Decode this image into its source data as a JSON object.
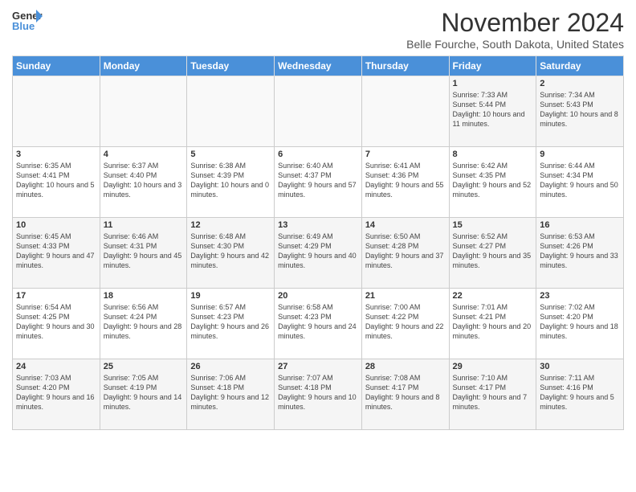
{
  "header": {
    "logo_line1": "General",
    "logo_line2": "Blue",
    "month": "November 2024",
    "location": "Belle Fourche, South Dakota, United States"
  },
  "days_of_week": [
    "Sunday",
    "Monday",
    "Tuesday",
    "Wednesday",
    "Thursday",
    "Friday",
    "Saturday"
  ],
  "weeks": [
    [
      {
        "day": "",
        "info": ""
      },
      {
        "day": "",
        "info": ""
      },
      {
        "day": "",
        "info": ""
      },
      {
        "day": "",
        "info": ""
      },
      {
        "day": "",
        "info": ""
      },
      {
        "day": "1",
        "info": "Sunrise: 7:33 AM\nSunset: 5:44 PM\nDaylight: 10 hours and 11 minutes."
      },
      {
        "day": "2",
        "info": "Sunrise: 7:34 AM\nSunset: 5:43 PM\nDaylight: 10 hours and 8 minutes."
      }
    ],
    [
      {
        "day": "3",
        "info": "Sunrise: 6:35 AM\nSunset: 4:41 PM\nDaylight: 10 hours and 5 minutes."
      },
      {
        "day": "4",
        "info": "Sunrise: 6:37 AM\nSunset: 4:40 PM\nDaylight: 10 hours and 3 minutes."
      },
      {
        "day": "5",
        "info": "Sunrise: 6:38 AM\nSunset: 4:39 PM\nDaylight: 10 hours and 0 minutes."
      },
      {
        "day": "6",
        "info": "Sunrise: 6:40 AM\nSunset: 4:37 PM\nDaylight: 9 hours and 57 minutes."
      },
      {
        "day": "7",
        "info": "Sunrise: 6:41 AM\nSunset: 4:36 PM\nDaylight: 9 hours and 55 minutes."
      },
      {
        "day": "8",
        "info": "Sunrise: 6:42 AM\nSunset: 4:35 PM\nDaylight: 9 hours and 52 minutes."
      },
      {
        "day": "9",
        "info": "Sunrise: 6:44 AM\nSunset: 4:34 PM\nDaylight: 9 hours and 50 minutes."
      }
    ],
    [
      {
        "day": "10",
        "info": "Sunrise: 6:45 AM\nSunset: 4:33 PM\nDaylight: 9 hours and 47 minutes."
      },
      {
        "day": "11",
        "info": "Sunrise: 6:46 AM\nSunset: 4:31 PM\nDaylight: 9 hours and 45 minutes."
      },
      {
        "day": "12",
        "info": "Sunrise: 6:48 AM\nSunset: 4:30 PM\nDaylight: 9 hours and 42 minutes."
      },
      {
        "day": "13",
        "info": "Sunrise: 6:49 AM\nSunset: 4:29 PM\nDaylight: 9 hours and 40 minutes."
      },
      {
        "day": "14",
        "info": "Sunrise: 6:50 AM\nSunset: 4:28 PM\nDaylight: 9 hours and 37 minutes."
      },
      {
        "day": "15",
        "info": "Sunrise: 6:52 AM\nSunset: 4:27 PM\nDaylight: 9 hours and 35 minutes."
      },
      {
        "day": "16",
        "info": "Sunrise: 6:53 AM\nSunset: 4:26 PM\nDaylight: 9 hours and 33 minutes."
      }
    ],
    [
      {
        "day": "17",
        "info": "Sunrise: 6:54 AM\nSunset: 4:25 PM\nDaylight: 9 hours and 30 minutes."
      },
      {
        "day": "18",
        "info": "Sunrise: 6:56 AM\nSunset: 4:24 PM\nDaylight: 9 hours and 28 minutes."
      },
      {
        "day": "19",
        "info": "Sunrise: 6:57 AM\nSunset: 4:23 PM\nDaylight: 9 hours and 26 minutes."
      },
      {
        "day": "20",
        "info": "Sunrise: 6:58 AM\nSunset: 4:23 PM\nDaylight: 9 hours and 24 minutes."
      },
      {
        "day": "21",
        "info": "Sunrise: 7:00 AM\nSunset: 4:22 PM\nDaylight: 9 hours and 22 minutes."
      },
      {
        "day": "22",
        "info": "Sunrise: 7:01 AM\nSunset: 4:21 PM\nDaylight: 9 hours and 20 minutes."
      },
      {
        "day": "23",
        "info": "Sunrise: 7:02 AM\nSunset: 4:20 PM\nDaylight: 9 hours and 18 minutes."
      }
    ],
    [
      {
        "day": "24",
        "info": "Sunrise: 7:03 AM\nSunset: 4:20 PM\nDaylight: 9 hours and 16 minutes."
      },
      {
        "day": "25",
        "info": "Sunrise: 7:05 AM\nSunset: 4:19 PM\nDaylight: 9 hours and 14 minutes."
      },
      {
        "day": "26",
        "info": "Sunrise: 7:06 AM\nSunset: 4:18 PM\nDaylight: 9 hours and 12 minutes."
      },
      {
        "day": "27",
        "info": "Sunrise: 7:07 AM\nSunset: 4:18 PM\nDaylight: 9 hours and 10 minutes."
      },
      {
        "day": "28",
        "info": "Sunrise: 7:08 AM\nSunset: 4:17 PM\nDaylight: 9 hours and 8 minutes."
      },
      {
        "day": "29",
        "info": "Sunrise: 7:10 AM\nSunset: 4:17 PM\nDaylight: 9 hours and 7 minutes."
      },
      {
        "day": "30",
        "info": "Sunrise: 7:11 AM\nSunset: 4:16 PM\nDaylight: 9 hours and 5 minutes."
      }
    ]
  ]
}
